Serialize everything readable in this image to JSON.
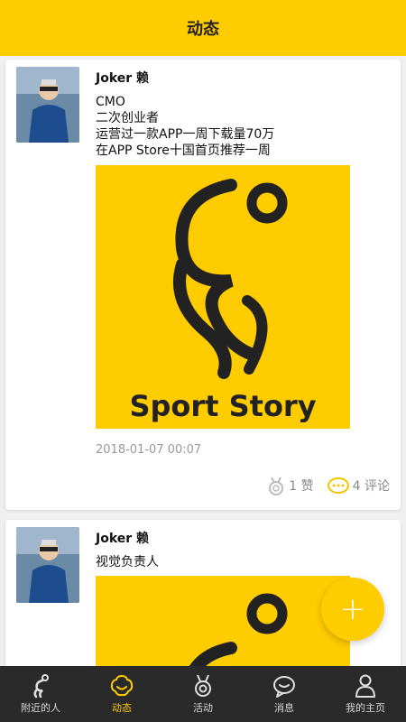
{
  "header": {
    "title": "动态"
  },
  "posts": [
    {
      "author": "Joker 赖",
      "lines": [
        "CMO",
        "二次创业者",
        "运营过一款APP一周下载量70万",
        "在APP Store十国首页推荐一周"
      ],
      "image_text": "Sport Story",
      "timestamp": "2018-01-07 00:07",
      "like_label": "1 赞",
      "comment_label": "4 评论"
    },
    {
      "author": "Joker 赖",
      "lines": [
        "视觉负责人"
      ]
    }
  ],
  "fab": {
    "label": "+"
  },
  "tabbar": {
    "items": [
      {
        "label": "附近的人",
        "icon": "runner-icon"
      },
      {
        "label": "动态",
        "icon": "smile-icon"
      },
      {
        "label": "活动",
        "icon": "medal-icon"
      },
      {
        "label": "消息",
        "icon": "chat-icon"
      },
      {
        "label": "我的主页",
        "icon": "person-icon"
      }
    ],
    "active_index": 1
  },
  "colors": {
    "accent": "#ffcc00",
    "tabbar_bg": "#2a2a2a"
  }
}
